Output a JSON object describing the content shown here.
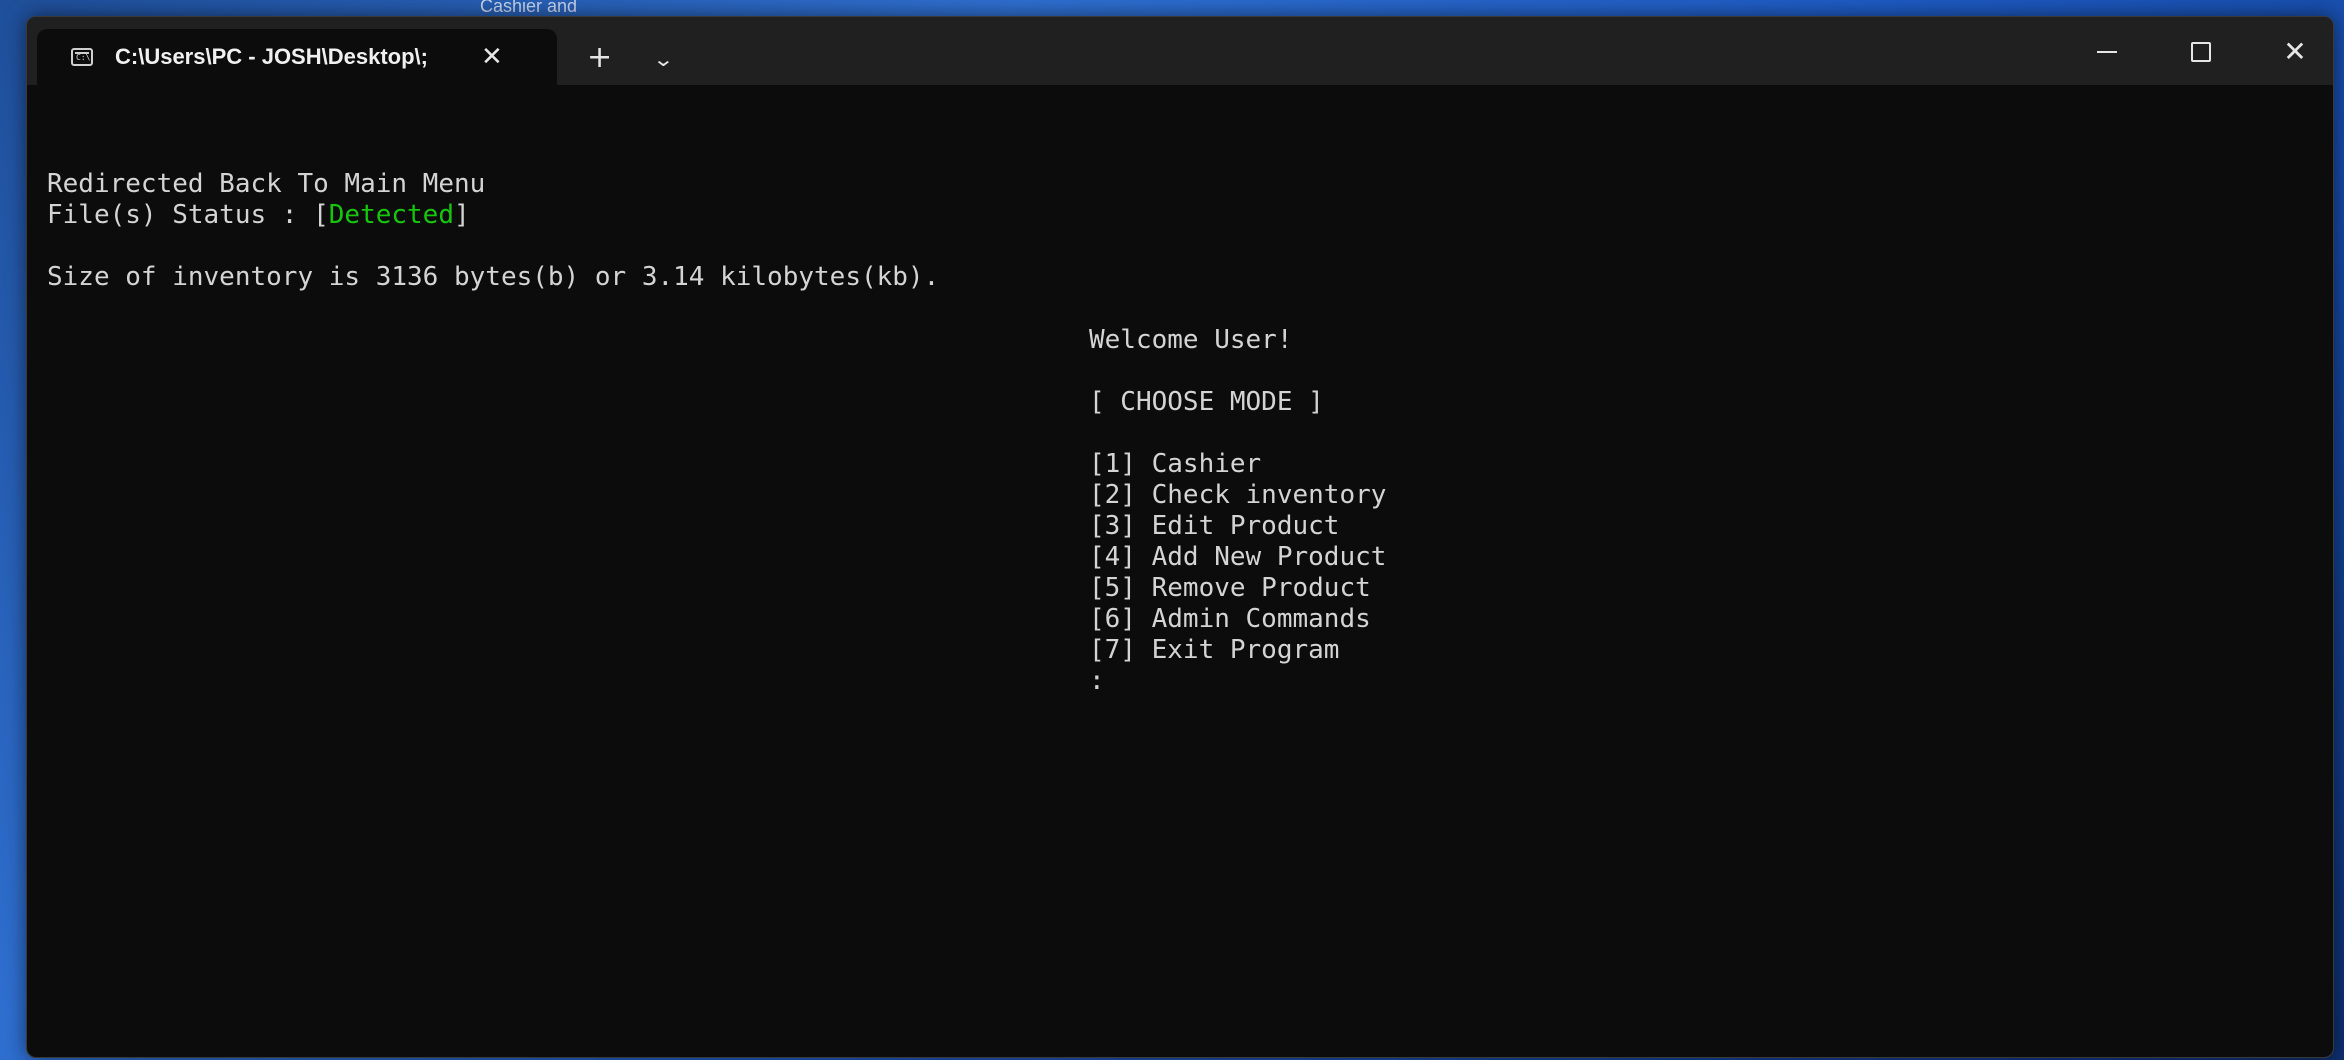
{
  "desktop": {
    "background_label": "Cashier and"
  },
  "window": {
    "tab_title": "C:\\Users\\PC - JOSH\\Desktop\\;",
    "tab_icon": "terminal-icon",
    "tab_icon_glyph": "C:\\",
    "tab_close_glyph": "✕",
    "new_tab_glyph": "+",
    "dropdown_glyph": "⌄",
    "close_glyph": "✕"
  },
  "console": {
    "redirect_line": "Redirected Back To Main Menu",
    "file_status_prefix": "File(s) Status : [",
    "file_status_value": "Detected",
    "file_status_suffix": "]",
    "size_line": "Size of inventory is 3136 bytes(b) or 3.14 kilobytes(kb).",
    "welcome": "Welcome User!",
    "choose_mode": "[ CHOOSE MODE ]",
    "menu": [
      "[1] Cashier",
      "[2] Check inventory",
      "[3] Edit Product",
      "[4] Add New Product",
      "[5] Remove Product",
      "[6] Admin Commands",
      "[7] Exit Program"
    ],
    "prompt": ":"
  },
  "colors": {
    "console_bg": "#0c0c0c",
    "console_text": "#d4d4d4",
    "status_green": "#16c60c",
    "titlebar": "#202020"
  }
}
